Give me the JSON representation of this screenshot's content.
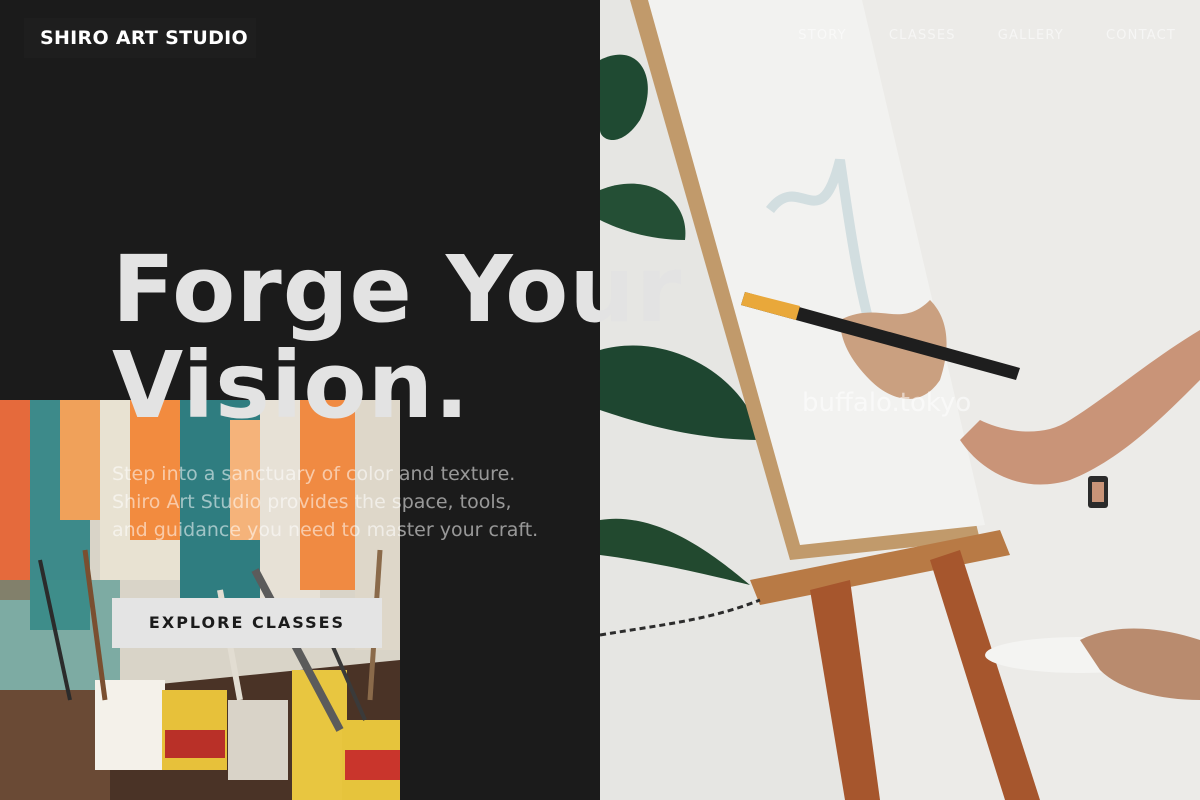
{
  "brand": {
    "name": "SHIRO ART STUDIO"
  },
  "nav": {
    "items": [
      "STORY",
      "CLASSES",
      "GALLERY",
      "CONTACT"
    ]
  },
  "hero": {
    "title_line1": "Forge Your",
    "title_line2": "Vision.",
    "description": "Step into a sanctuary of color and texture. Shiro Art Studio provides the space, tools, and guidance you need to master your craft.",
    "cta_label": "EXPLORE CLASSES"
  },
  "image_credit": "buffalo.tokyo",
  "colors": {
    "background": "#1b1b1b",
    "hero_text": "#e3e3e3",
    "button_bg": "#e4e4e4",
    "button_text": "#1b1b1b"
  }
}
